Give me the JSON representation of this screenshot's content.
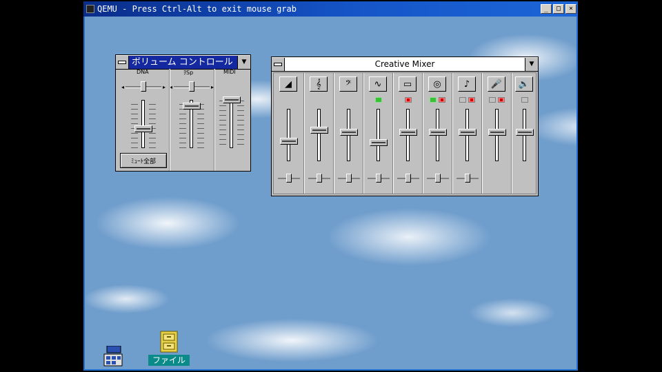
{
  "host_window": {
    "title": "QEMU - Press Ctrl-Alt to exit mouse grab",
    "buttons": {
      "minimize": "_",
      "maximize": "□",
      "close": "×"
    }
  },
  "volume_control": {
    "title": "ボリューム コントロール",
    "columns": [
      {
        "label": "DNA"
      },
      {
        "label": "ｦSp"
      },
      {
        "label": "MIDI"
      }
    ],
    "button_label": "ﾐｭｰﾄ全部"
  },
  "creative_mixer": {
    "title": "Creative Mixer",
    "channels": [
      {
        "icon": "master-volume-icon",
        "glyph": "◢"
      },
      {
        "icon": "treble-icon",
        "glyph": "𝄞"
      },
      {
        "icon": "bass-icon",
        "glyph": "𝄢"
      },
      {
        "icon": "wave-icon",
        "glyph": "∿"
      },
      {
        "icon": "line-in-icon",
        "glyph": "▭"
      },
      {
        "icon": "cd-icon",
        "glyph": "◎"
      },
      {
        "icon": "midi-icon",
        "glyph": "♪"
      },
      {
        "icon": "microphone-icon",
        "glyph": "🎤"
      },
      {
        "icon": "pc-speaker-icon",
        "glyph": "🔊"
      }
    ]
  },
  "desktop_icons": [
    {
      "icon": "program-group-icon",
      "label": ""
    },
    {
      "icon": "file-cabinet-icon",
      "label": "ファイル"
    }
  ]
}
